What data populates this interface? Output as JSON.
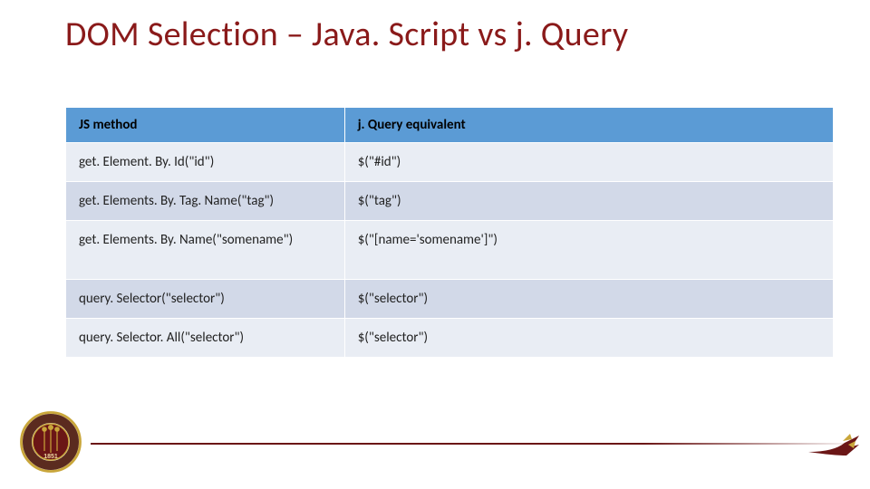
{
  "title": "DOM Selection – Java. Script vs j. Query",
  "table": {
    "headers": [
      "JS method",
      "j. Query equivalent"
    ],
    "rows": [
      {
        "js": "get. Element. By. Id(\"id\")",
        "jq": "$(\"#id\")"
      },
      {
        "js": "get. Elements. By. Tag. Name(\"tag\")",
        "jq": "$(\"tag\")"
      },
      {
        "js": "get. Elements. By. Name(\"somename\")",
        "jq": "$(\"[name='somename']\")",
        "tall": true
      },
      {
        "js": "query. Selector(\"selector\")",
        "jq": "$(\"selector\")"
      },
      {
        "js": "query. Selector. All(\"selector\")",
        "jq": "$(\"selector\")"
      }
    ]
  },
  "footer": {
    "seal_year": "1851"
  }
}
